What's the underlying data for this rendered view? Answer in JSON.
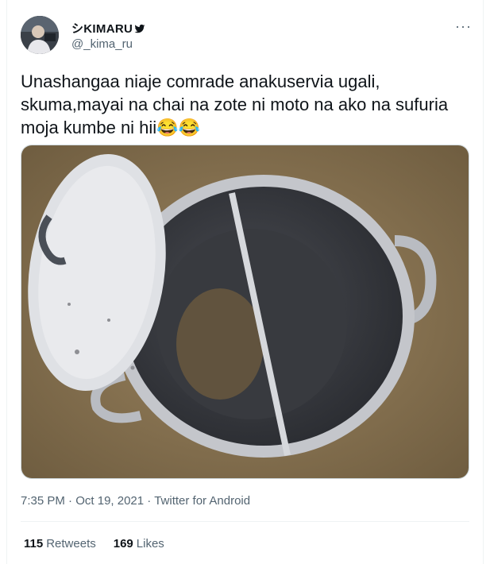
{
  "tweet": {
    "author": {
      "display_name": "シKIMARU",
      "handle": "@_kima_ru",
      "avatar_icon": "user-avatar"
    },
    "more_label": "···",
    "text": "Unashangaa niaje comrade anakuservia ugali, skuma,mayai na chai na zote ni moto na ako na sufuria moja kumbe ni hii😂😂",
    "media": {
      "description_icon": "divided-cooking-pot-photo"
    },
    "meta": {
      "time": "7:35 PM",
      "separator1": "·",
      "date": "Oct 19, 2021",
      "separator2": "·",
      "source": "Twitter for Android"
    },
    "stats": {
      "retweets_count": "115",
      "retweets_label": "Retweets",
      "likes_count": "169",
      "likes_label": "Likes"
    }
  },
  "colors": {
    "text_primary": "#0f1419",
    "text_secondary": "#536471",
    "border": "#eff3f4"
  }
}
